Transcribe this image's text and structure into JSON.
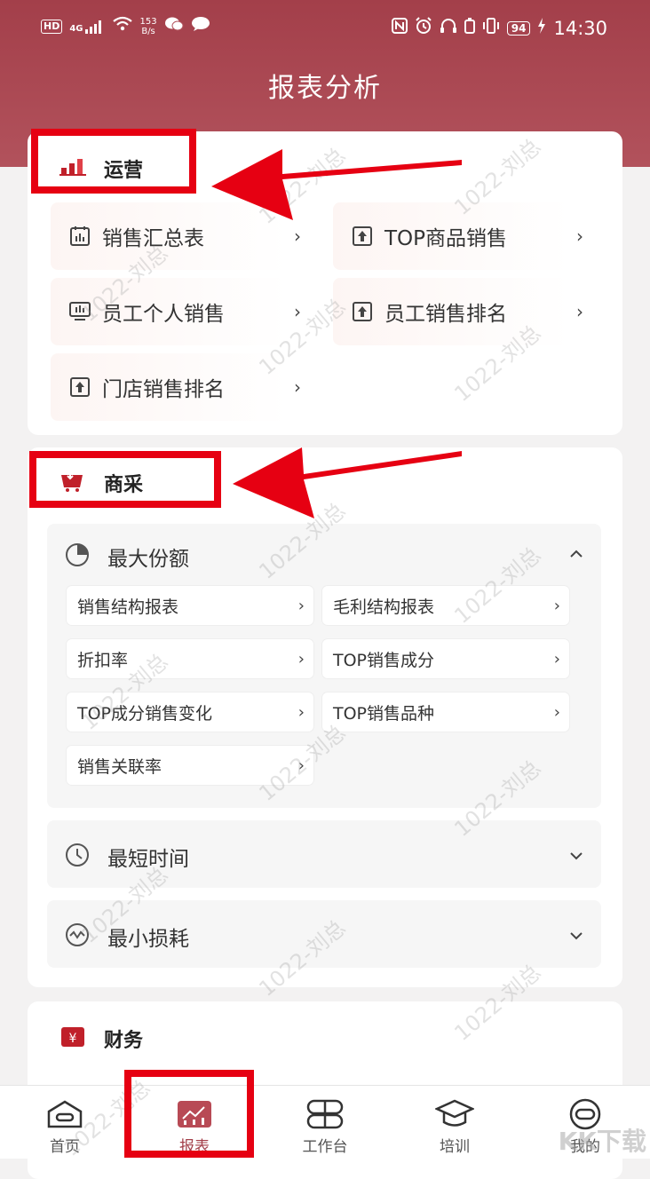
{
  "status_bar": {
    "hd_badge": "HD",
    "signal": "4G",
    "net_speed_value": "153",
    "net_speed_unit": "B/s",
    "battery": "94",
    "time": "14:30"
  },
  "header": {
    "title": "报表分析"
  },
  "operations": {
    "title": "运营",
    "items": [
      {
        "label": "销售汇总表",
        "icon": "table-icon"
      },
      {
        "label": "TOP商品销售",
        "icon": "upload-box-icon"
      },
      {
        "label": "员工个人销售",
        "icon": "chart-screen-icon"
      },
      {
        "label": "员工销售排名",
        "icon": "upload-box-icon"
      },
      {
        "label": "门店销售排名",
        "icon": "upload-box-icon"
      }
    ]
  },
  "purchasing": {
    "title": "商采",
    "groups": [
      {
        "title": "最大份额",
        "icon": "pie-chart-icon",
        "expanded": true,
        "items": [
          "销售结构报表",
          "毛利结构报表",
          "折扣率",
          "TOP销售成分",
          "TOP成分销售变化",
          "TOP销售品种",
          "销售关联率"
        ]
      },
      {
        "title": "最短时间",
        "icon": "clock-icon",
        "expanded": false
      },
      {
        "title": "最小损耗",
        "icon": "wave-circle-icon",
        "expanded": false
      }
    ]
  },
  "finance": {
    "title": "财务"
  },
  "tabbar": {
    "items": [
      {
        "label": "首页",
        "icon": "home-icon"
      },
      {
        "label": "报表",
        "icon": "report-chart-icon",
        "active": true
      },
      {
        "label": "工作台",
        "icon": "workbench-icon"
      },
      {
        "label": "培训",
        "icon": "graduation-cap-icon"
      },
      {
        "label": "我的",
        "icon": "profile-icon"
      }
    ]
  },
  "watermark": "1022-刘总",
  "corner_logo": "KK下载",
  "colors": {
    "brand": "#a33f4a",
    "annotation_red": "#e60012",
    "background": "#f3f2f2"
  }
}
